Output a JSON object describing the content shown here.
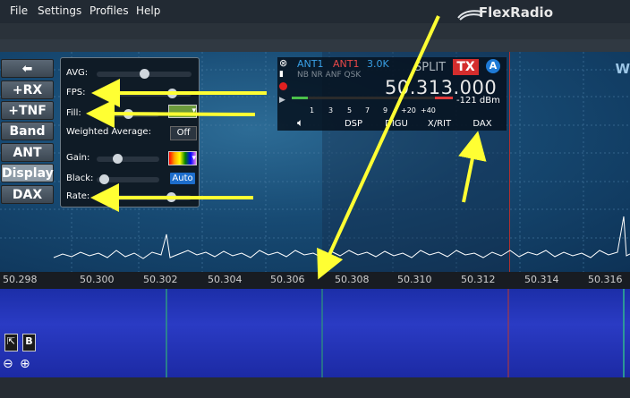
{
  "menu": {
    "file": "File",
    "settings": "Settings",
    "profiles": "Profiles",
    "help": "Help"
  },
  "brand": {
    "name": "FlexRadio"
  },
  "sidebar": {
    "collapse_icon": "arrow-left-icon",
    "items": [
      {
        "label": "+RX"
      },
      {
        "label": "+TNF"
      },
      {
        "label": "Band"
      },
      {
        "label": "ANT"
      },
      {
        "label": "Display"
      },
      {
        "label": "DAX"
      }
    ]
  },
  "display_panel": {
    "avg_label": "AVG:",
    "avg_value": 0.5,
    "fps_label": "FPS:",
    "fps_value": 0.83,
    "fill_label": "Fill:",
    "fill_value": 0.5,
    "fill_color": "#6c9a3c",
    "weighted_average_label": "Weighted Average:",
    "weighted_average_value": "Off",
    "gain_label": "Gain:",
    "gain_value": 0.3,
    "black_label": "Black:",
    "black_value": 0.05,
    "black_auto": "Auto",
    "rate_label": "Rate:",
    "rate_value": 0.82
  },
  "slice": {
    "ant_rx": "ANT1",
    "ant_tx": "ANT1",
    "filter": "3.0K",
    "modes": "NB NR ANF QSK",
    "split": "SPLIT",
    "tx_badge": "TX",
    "slice_letter": "A",
    "frequency": "50.313.000",
    "signal": "-121 dBm",
    "s_scale": [
      "1",
      "3",
      "5",
      "7",
      "9",
      "+20",
      "+40"
    ],
    "buttons": [
      "DSP",
      "DIGU",
      "X/RIT",
      "DAX"
    ],
    "speaker_icon": "speaker-icon"
  },
  "panadapter": {
    "scale_labels": [
      "50.298",
      "50.300",
      "50.302",
      "50.304",
      "50.306",
      "50.308",
      "50.310",
      "50.312",
      "50.314",
      "50.316"
    ],
    "accent_red": "#c0392b",
    "highlight_yellow": "#ffff33",
    "right_label": "W"
  },
  "waterfall_tools": {
    "select_icon": "cursor-icon",
    "b_label": "B",
    "zoom_out_icon": "zoom-out-icon",
    "zoom_in_icon": "zoom-in-icon"
  }
}
